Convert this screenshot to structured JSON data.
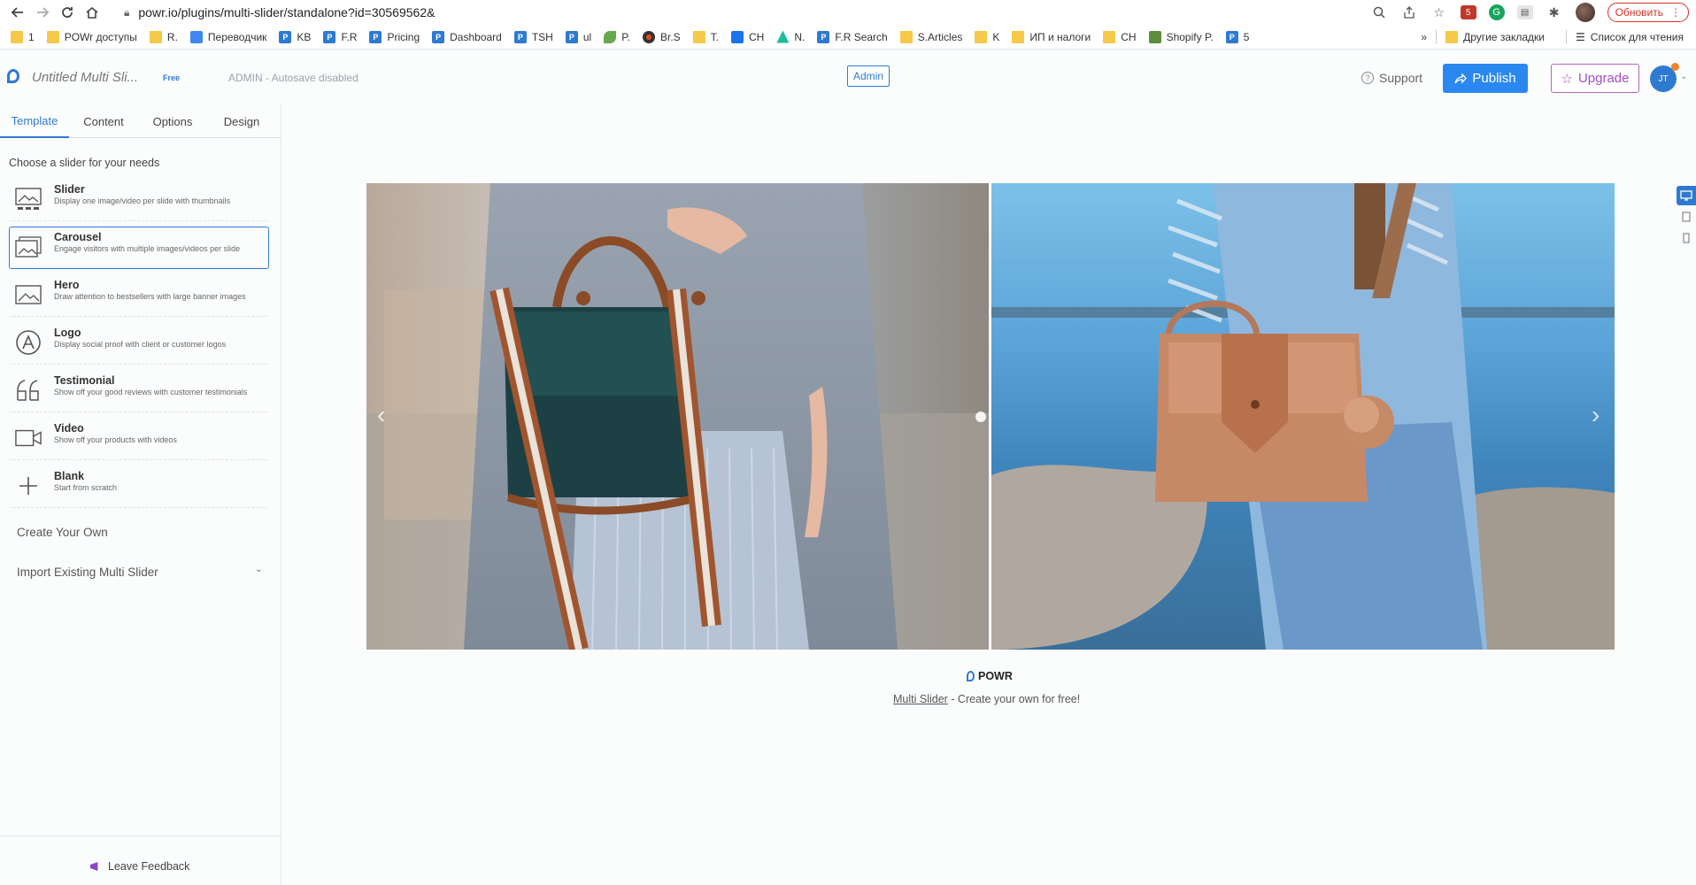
{
  "browser": {
    "url": "powr.io/plugins/multi-slider/standalone?id=30569562&",
    "update_label": "Обновить",
    "ext_badge": "5"
  },
  "bookmarks": [
    {
      "label": "1",
      "icon": "folder"
    },
    {
      "label": "POWr доступы",
      "icon": "folder"
    },
    {
      "label": "R.",
      "icon": "folder"
    },
    {
      "label": "Переводчик",
      "icon": "translate"
    },
    {
      "label": "KB",
      "icon": "powr"
    },
    {
      "label": "F.R",
      "icon": "powr"
    },
    {
      "label": "Pricing",
      "icon": "powr"
    },
    {
      "label": "Dashboard",
      "icon": "powr"
    },
    {
      "label": "TSH",
      "icon": "powr"
    },
    {
      "label": "ul",
      "icon": "powr"
    },
    {
      "label": "P.",
      "icon": "green"
    },
    {
      "label": "Br.S",
      "icon": "br"
    },
    {
      "label": "T.",
      "icon": "folder"
    },
    {
      "label": "CH",
      "icon": "blue-sq"
    },
    {
      "label": "N.",
      "icon": "cyan"
    },
    {
      "label": "F.R Search",
      "icon": "powr"
    },
    {
      "label": "S.Articles",
      "icon": "folder"
    },
    {
      "label": "K",
      "icon": "folder"
    },
    {
      "label": "ИП и налоги",
      "icon": "folder"
    },
    {
      "label": "CH",
      "icon": "folder"
    },
    {
      "label": "Shopify P.",
      "icon": "shopify"
    },
    {
      "label": "5",
      "icon": "powr"
    }
  ],
  "bookmarks_right": {
    "overflow": "»",
    "other": "Другие закладки",
    "reading_list": "Список для чтения"
  },
  "header": {
    "title": "Untitled Multi Sli...",
    "plan_badge": "Free",
    "admin_note": "ADMIN - Autosave disabled",
    "admin_badge": "Admin",
    "support": "Support",
    "publish": "Publish",
    "upgrade": "Upgrade",
    "user_initials": "JT"
  },
  "sidebar": {
    "tabs": [
      "Template",
      "Content",
      "Options",
      "Design"
    ],
    "active_tab": "Template",
    "heading": "Choose a slider for your needs",
    "templates": [
      {
        "title": "Slider",
        "desc": "Display one image/video per slide with thumbnails",
        "icon": "slider-icon"
      },
      {
        "title": "Carousel",
        "desc": "Engage visitors with multiple images/videos per slide",
        "icon": "carousel-icon"
      },
      {
        "title": "Hero",
        "desc": "Draw attention to bestsellers with large banner images",
        "icon": "hero-icon"
      },
      {
        "title": "Logo",
        "desc": "Display social proof with client or customer logos",
        "icon": "logo-icon"
      },
      {
        "title": "Testimonial",
        "desc": "Show off your good reviews with customer testimonials",
        "icon": "quote-icon"
      },
      {
        "title": "Video",
        "desc": "Show off your products with videos",
        "icon": "video-icon"
      },
      {
        "title": "Blank",
        "desc": "Start from scratch",
        "icon": "plus-icon"
      }
    ],
    "create_own": "Create Your Own",
    "import": "Import Existing Multi Slider",
    "feedback": "Leave Feedback"
  },
  "main": {
    "brand": "POWR",
    "credit_link": "Multi Slider",
    "credit_text": " - Create your own for free!"
  },
  "colors": {
    "accent": "#2b88f0",
    "upgrade": "#a14fbf"
  }
}
